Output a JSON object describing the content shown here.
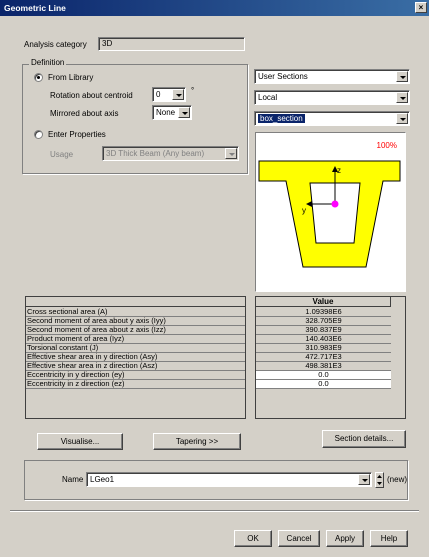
{
  "window": {
    "title": "Geometric Line",
    "close_glyph": "×"
  },
  "analysis_category": {
    "label": "Analysis category",
    "value": "3D"
  },
  "definition": {
    "group_label": "Definition",
    "from_library": {
      "label": "From Library",
      "selected": true
    },
    "rotation": {
      "label": "Rotation about centroid",
      "value": "0",
      "unit": "°"
    },
    "mirrored": {
      "label": "Mirrored about axis",
      "value": "None"
    },
    "enter_properties": {
      "label": "Enter Properties",
      "selected": false
    },
    "usage": {
      "label": "Usage",
      "value": "3D Thick Beam (Any beam)"
    }
  },
  "library": {
    "source": "User Sections",
    "location": "Local",
    "section": "box_section"
  },
  "preview": {
    "zoom": "100%",
    "axis_y": "y",
    "axis_z": "z",
    "colors": {
      "fill": "#ffff00",
      "outline": "#000000",
      "centroid": "#ff00ff",
      "zoom_text": "#ff0000"
    }
  },
  "properties": {
    "value_header": "Value",
    "rows": [
      {
        "name": "Cross sectional area (A)",
        "value": "1.09398E6",
        "editable": false
      },
      {
        "name": "Second moment of area about y axis (Iyy)",
        "value": "328.705E9",
        "editable": false
      },
      {
        "name": "Second moment of area about z axis (Izz)",
        "value": "390.837E9",
        "editable": false
      },
      {
        "name": "Product moment of area (Iyz)",
        "value": "140.403E6",
        "editable": false
      },
      {
        "name": "Torsional constant (J)",
        "value": "310.983E9",
        "editable": false
      },
      {
        "name": "Effective shear area in y direction (Asy)",
        "value": "472.717E3",
        "editable": false
      },
      {
        "name": "Effective shear area in z direction (Asz)",
        "value": "498.381E3",
        "editable": false
      },
      {
        "name": "Eccentricity in y direction (ey)",
        "value": "0.0",
        "editable": true
      },
      {
        "name": "Eccentricity in z direction (ez)",
        "value": "0.0",
        "editable": true
      }
    ]
  },
  "buttons": {
    "visualise": "Visualise...",
    "tapering": "Tapering >>",
    "section_details": "Section details...",
    "ok": "OK",
    "cancel": "Cancel",
    "apply": "Apply",
    "help": "Help"
  },
  "name_row": {
    "label": "Name",
    "value": "LGeo1",
    "status": "(new)"
  }
}
